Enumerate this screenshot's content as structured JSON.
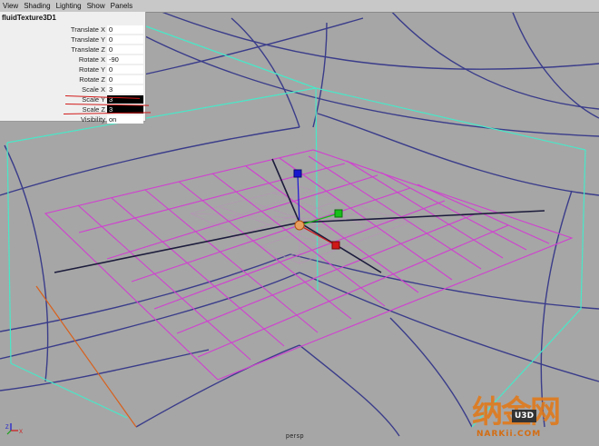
{
  "menubar": {
    "items": [
      "View",
      "Shading",
      "Lighting",
      "Show",
      "Panels"
    ]
  },
  "channel_box": {
    "node_name": "fluidTexture3D1",
    "attributes": [
      {
        "label": "Translate X",
        "value": "0",
        "selected": false
      },
      {
        "label": "Translate Y",
        "value": "0",
        "selected": false
      },
      {
        "label": "Translate Z",
        "value": "0",
        "selected": false
      },
      {
        "label": "Rotate X",
        "value": "-90",
        "selected": false
      },
      {
        "label": "Rotate Y",
        "value": "0",
        "selected": false
      },
      {
        "label": "Rotate Z",
        "value": "0",
        "selected": false
      },
      {
        "label": "Scale X",
        "value": "3",
        "selected": false
      },
      {
        "label": "Scale Y",
        "value": "3",
        "selected": true
      },
      {
        "label": "Scale Z",
        "value": "3",
        "selected": true
      },
      {
        "label": "Visibility",
        "value": "on",
        "selected": false
      }
    ]
  },
  "viewport": {
    "camera_label": "persp",
    "colors": {
      "background": "#a6a6a6",
      "fluid_box": "#48e8c8",
      "texture_grid": "#d040d0",
      "world_grid": "#3a3c8a",
      "inner_grid": "#b890b8",
      "manipulator_x": "#d01818",
      "manipulator_y": "#18c018",
      "manipulator_z": "#1818d0",
      "annotation_red": "#d21a1a"
    }
  },
  "axis_gizmo": {
    "x_label": "X",
    "z_label": "Z"
  },
  "watermark": {
    "chinese": "纳金网",
    "mid_badge": "U3D",
    "domain": "NARKii.COM"
  }
}
